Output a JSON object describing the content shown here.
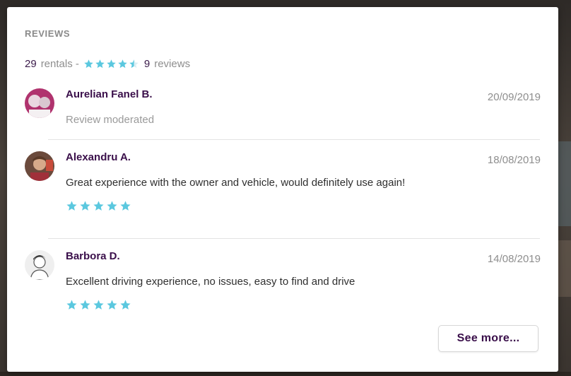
{
  "section_title": "REVIEWS",
  "summary": {
    "rentals_count": "29",
    "rentals_label": "rentals -",
    "rating_stars": 4.5,
    "reviews_count": "9",
    "reviews_label": "reviews"
  },
  "colors": {
    "star": "#5bc8df",
    "name": "#3a0f4a",
    "muted": "#8e8e8e"
  },
  "reviews": [
    {
      "name": "Aurelian Fanel B.",
      "date": "20/09/2019",
      "text": "Review moderated",
      "stars": null,
      "avatar_icon": "avatar-photo-icon"
    },
    {
      "name": "Alexandru A.",
      "date": "18/08/2019",
      "text": "Great experience with the owner and vehicle, would definitely use again!",
      "stars": 5,
      "avatar_icon": "avatar-photo-icon"
    },
    {
      "name": "Barbora D.",
      "date": "14/08/2019",
      "text": "Excellent driving experience, no issues, easy to find and drive",
      "stars": 5,
      "avatar_icon": "avatar-photo-icon"
    }
  ],
  "see_more_label": "See more..."
}
